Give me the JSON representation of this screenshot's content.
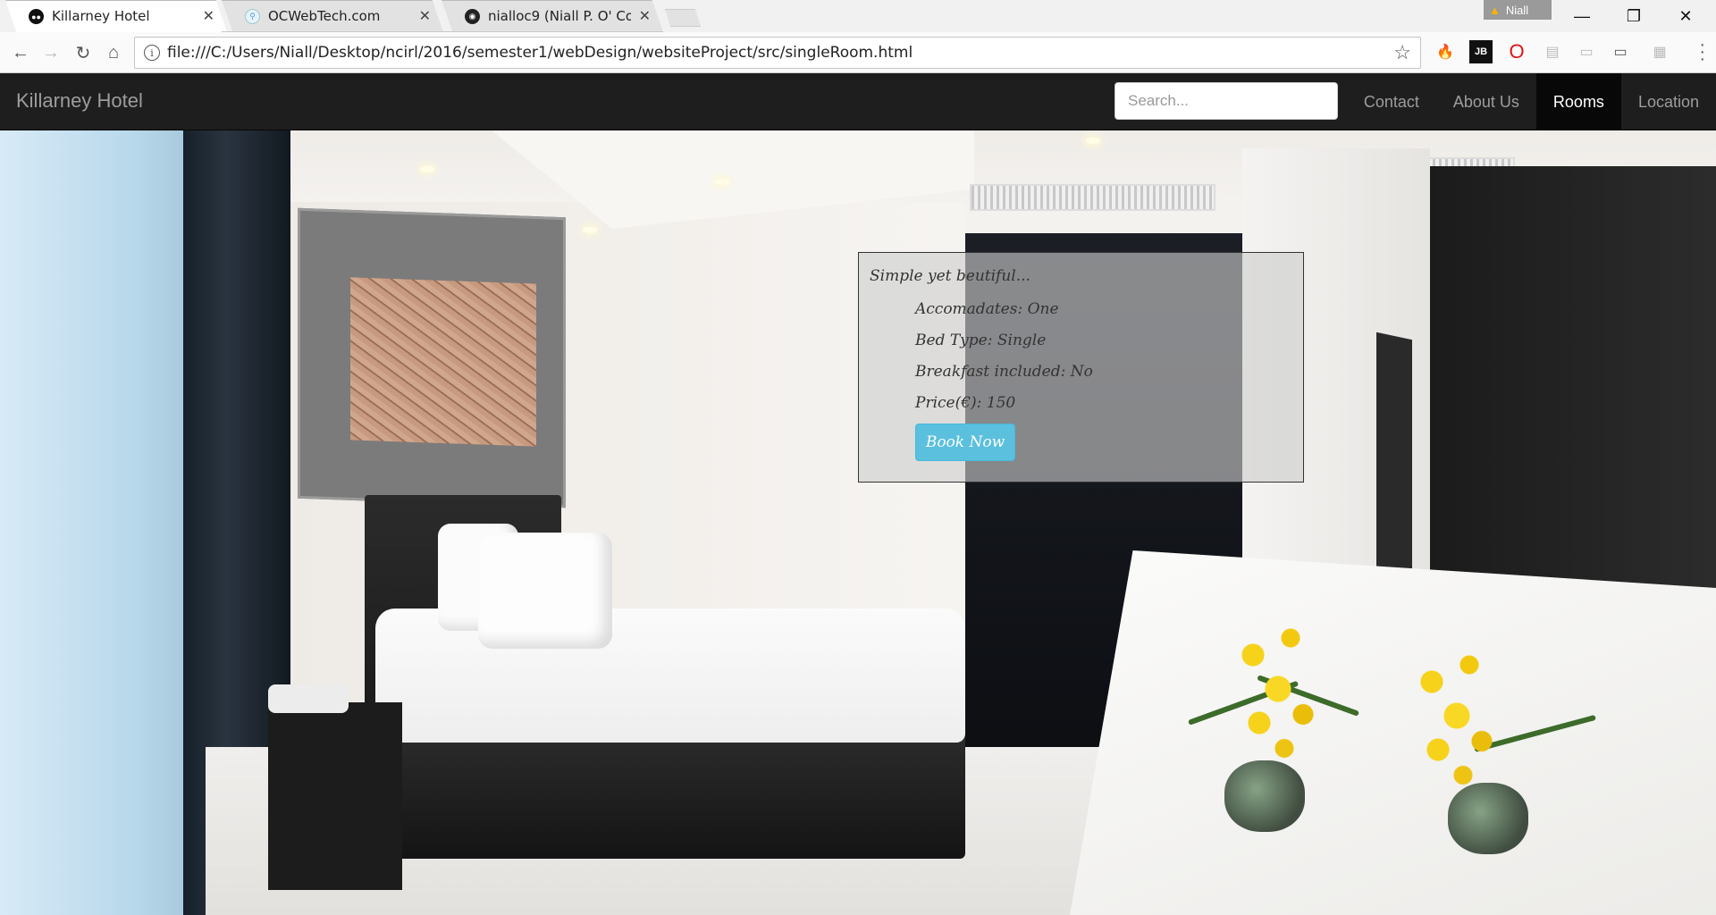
{
  "browser": {
    "tabs": [
      {
        "title": "Killarney Hotel",
        "active": true,
        "favicon": "hotel-favicon"
      },
      {
        "title": "OCWebTech.com",
        "active": false,
        "favicon": "location-pin-favicon"
      },
      {
        "title": "nialloc9 (Niall P. O' Conn",
        "active": false,
        "favicon": "github-favicon"
      }
    ],
    "profile_name": "Niall",
    "url": "file:///C:/Users/Niall/Desktop/ncirl/2016/semester1/webDesign/websiteProject/src/singleRoom.html"
  },
  "site": {
    "brand": "Killarney Hotel",
    "search_placeholder": "Search...",
    "nav": [
      {
        "label": "Contact",
        "active": false
      },
      {
        "label": "About Us",
        "active": false
      },
      {
        "label": "Rooms",
        "active": true
      },
      {
        "label": "Location",
        "active": false
      }
    ]
  },
  "room_card": {
    "tagline": "Simple yet beutiful...",
    "details": [
      "Accomadates: One",
      "Bed Type: Single",
      "Breakfast included: No",
      "Price(€): 150"
    ],
    "button": "Book Now"
  },
  "colors": {
    "navbar_bg": "#1e1e1e",
    "active_nav_bg": "#080808",
    "book_button": "#5bc0de"
  }
}
